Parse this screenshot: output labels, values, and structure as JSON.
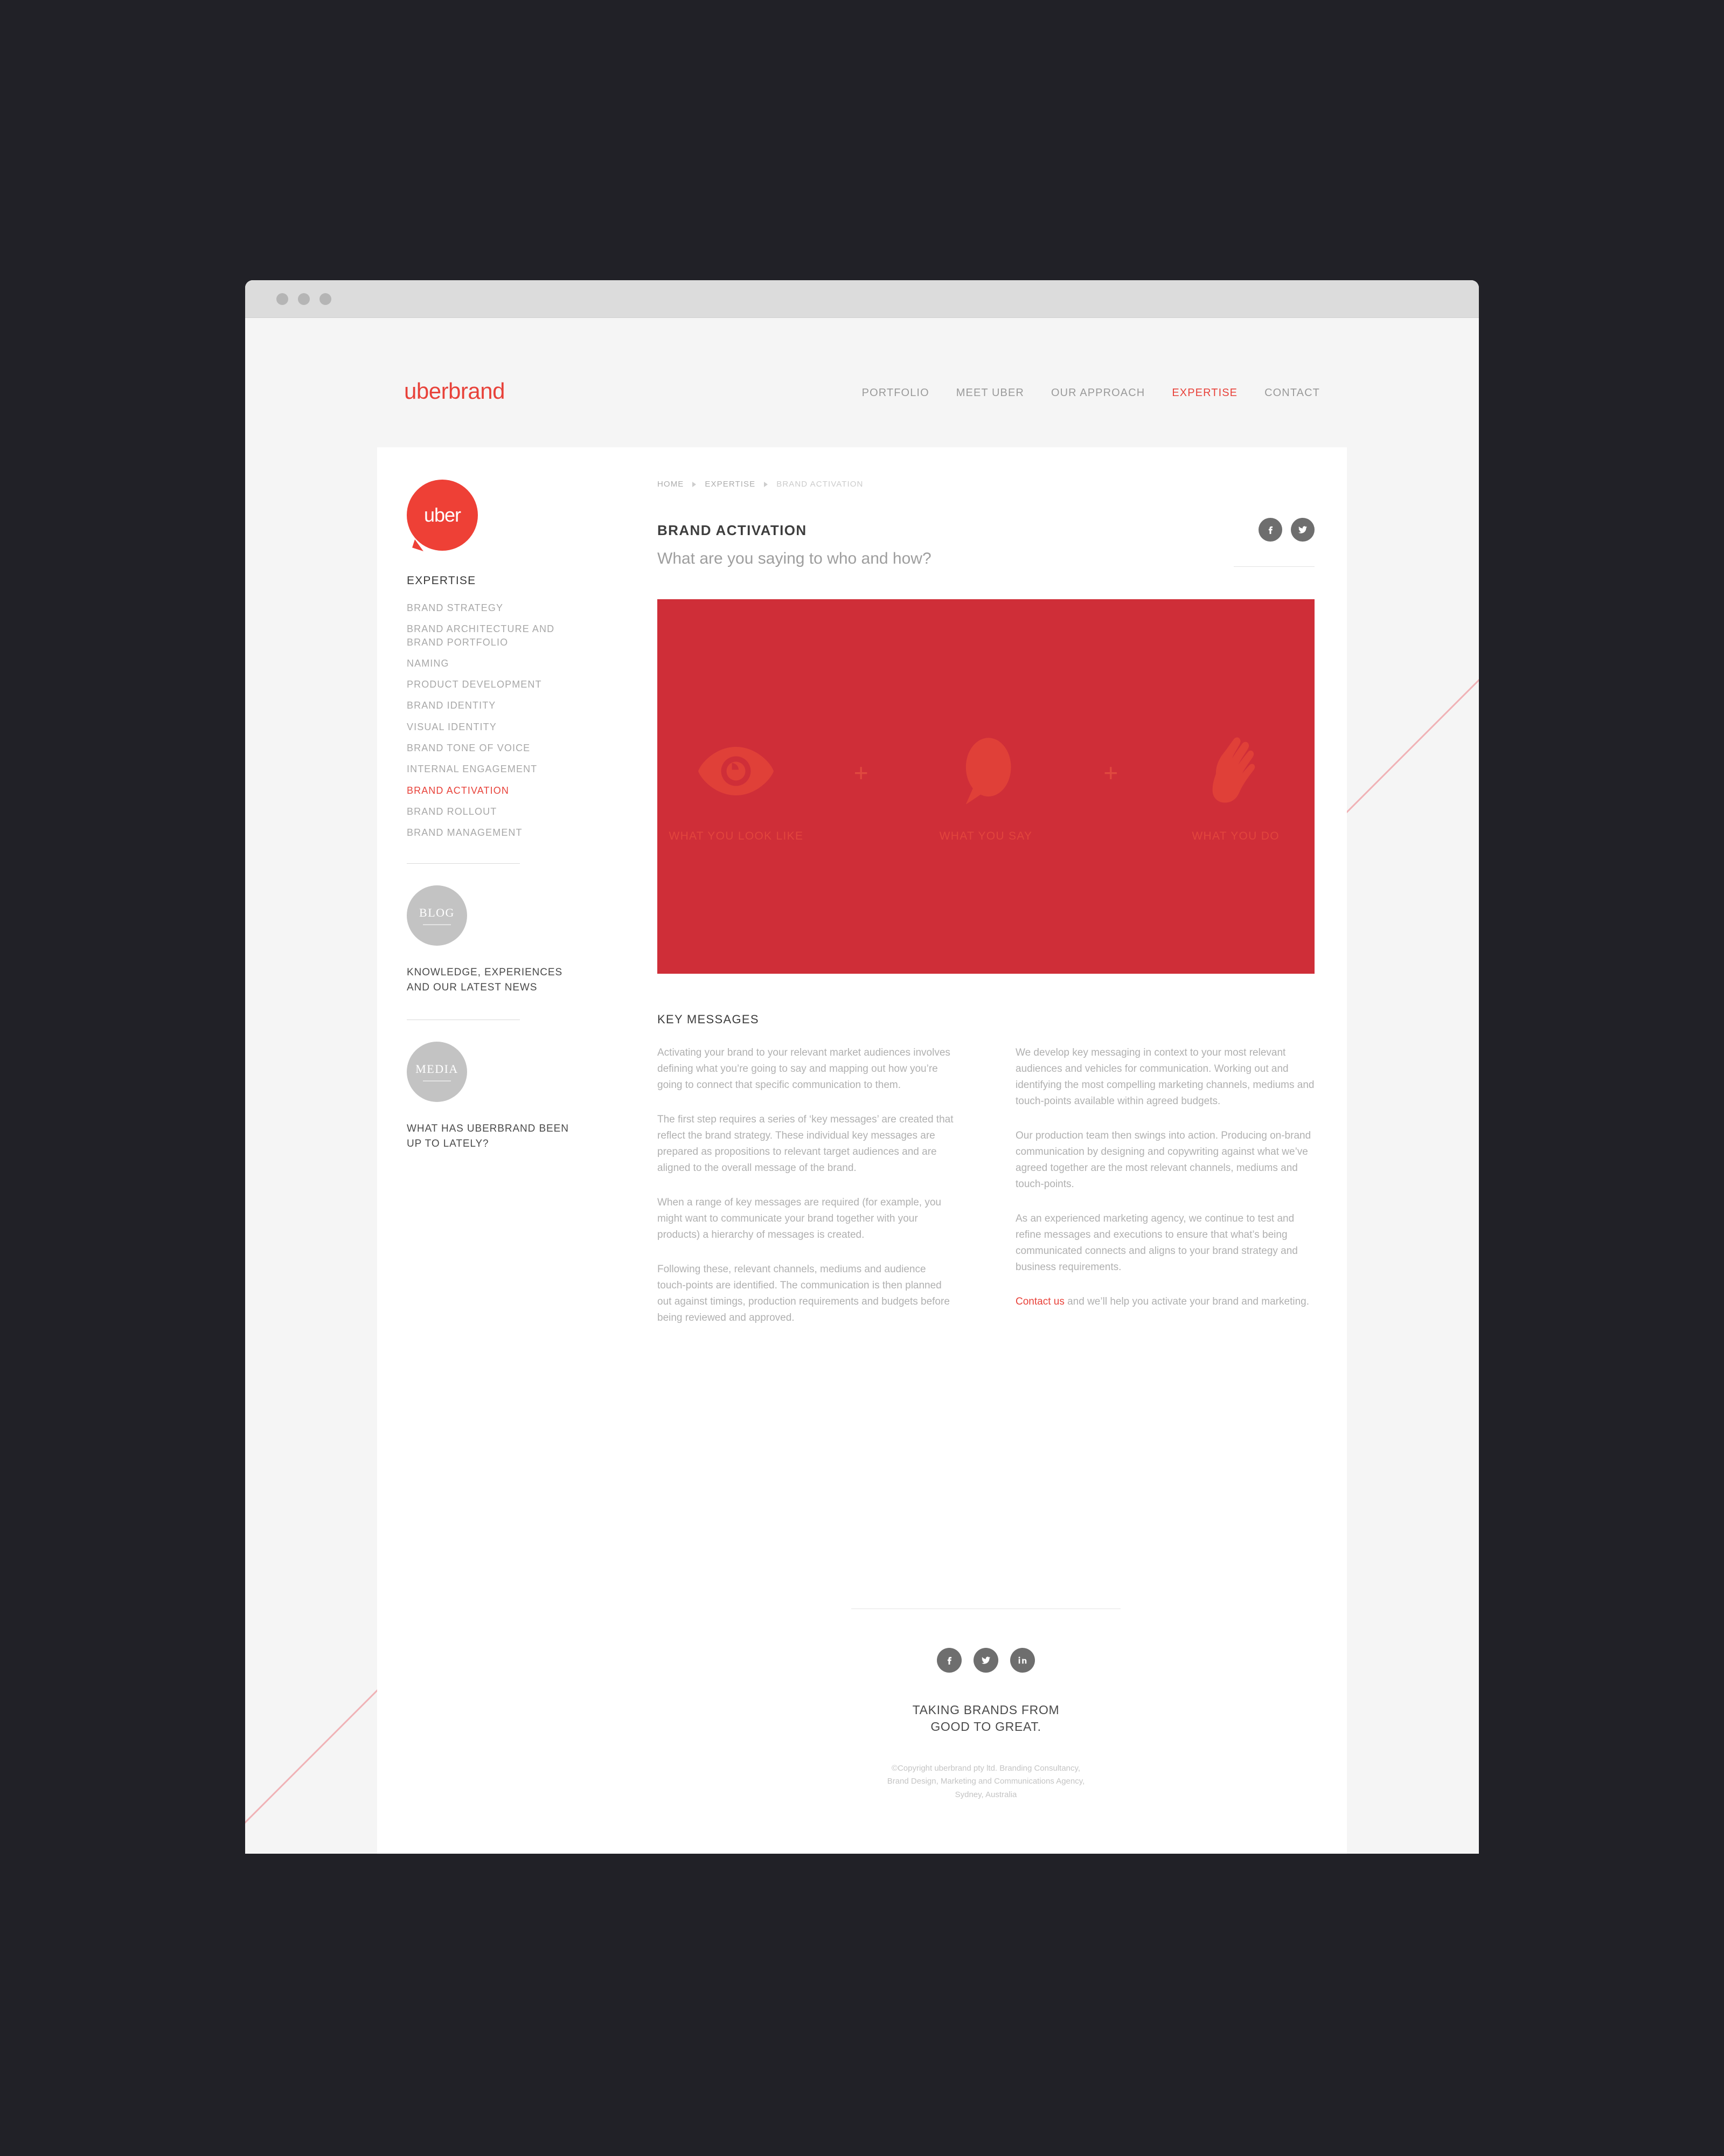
{
  "window": {
    "traffic_lights": [
      "close",
      "minimize",
      "maximize"
    ]
  },
  "header": {
    "logo": "uberbrand",
    "nav": [
      {
        "label": "PORTFOLIO",
        "active": false
      },
      {
        "label": "MEET UBER",
        "active": false
      },
      {
        "label": "OUR APPROACH",
        "active": false
      },
      {
        "label": "EXPERTISE",
        "active": true
      },
      {
        "label": "CONTACT",
        "active": false
      }
    ]
  },
  "sidebar": {
    "logo_bubble": "uber",
    "heading": "EXPERTISE",
    "items": [
      {
        "label": "BRAND STRATEGY",
        "active": false
      },
      {
        "label": "BRAND ARCHITECTURE AND BRAND PORTFOLIO",
        "active": false
      },
      {
        "label": "NAMING",
        "active": false
      },
      {
        "label": "PRODUCT DEVELOPMENT",
        "active": false
      },
      {
        "label": "BRAND IDENTITY",
        "active": false
      },
      {
        "label": "VISUAL IDENTITY",
        "active": false
      },
      {
        "label": "BRAND TONE OF VOICE",
        "active": false
      },
      {
        "label": "INTERNAL ENGAGEMENT",
        "active": false
      },
      {
        "label": "BRAND ACTIVATION",
        "active": true
      },
      {
        "label": "BRAND ROLLOUT",
        "active": false
      },
      {
        "label": "BRAND MANAGEMENT",
        "active": false
      }
    ],
    "promos": [
      {
        "badge": "BLOG",
        "text": "KNOWLEDGE, EXPERIENCES AND OUR LATEST NEWS"
      },
      {
        "badge": "MEDIA",
        "text": "WHAT HAS UBERBRAND BEEN UP TO LATELY?"
      }
    ]
  },
  "main": {
    "breadcrumb": [
      {
        "label": "HOME",
        "current": false
      },
      {
        "label": "EXPERTISE",
        "current": false
      },
      {
        "label": "BRAND ACTIVATION",
        "current": true
      }
    ],
    "title": "BRAND ACTIVATION",
    "subtitle": "What are you saying to who and how?",
    "share": [
      {
        "name": "facebook-icon"
      },
      {
        "name": "twitter-icon"
      }
    ],
    "hero": {
      "background_color": "#cf2e38",
      "items": [
        {
          "icon": "eye-icon",
          "caption": "WHAT YOU LOOK LIKE"
        },
        {
          "icon": "speech-bubble-icon",
          "caption": "WHAT YOU SAY"
        },
        {
          "icon": "hand-icon",
          "caption": "WHAT YOU DO"
        }
      ],
      "separator": "+"
    },
    "section_heading": "KEY MESSAGES",
    "left_column": [
      "Activating your brand to your relevant market audiences involves defining what you’re going to say and mapping out how you’re going to connect that specific communication to them.",
      "The first step requires a series of ‘key messages’ are created that reflect the brand strategy. These individual key messages are prepared as propositions to relevant target audiences and are aligned to the overall message of the brand.",
      "When a range of key messages are required (for example, you might want to communicate your brand together with your products) a hierarchy of messages is created.",
      "Following these, relevant channels, mediums and audience touch-points are identified. The communication is then planned out against timings, production requirements and budgets before being reviewed and approved."
    ],
    "right_column": [
      "We develop key messaging in context to your most relevant audiences and vehicles for communication. Working out and identifying the most compelling marketing channels, mediums and touch-points available within agreed budgets.",
      "Our production team then swings into action. Producing on-brand communication by designing and copywriting against what we’ve agreed together are the most relevant channels, mediums and touch-points.",
      "As an experienced marketing agency, we continue to test and refine messages and executions to ensure that what’s being communicated connects and aligns to your brand strategy and business requirements."
    ],
    "cta": {
      "link": "Contact us",
      "rest": " and we’ll help you activate your brand and marketing."
    }
  },
  "footer": {
    "social": [
      {
        "name": "facebook-icon"
      },
      {
        "name": "twitter-icon"
      },
      {
        "name": "linkedin-icon"
      }
    ],
    "tagline_line1": "TAKING BRANDS FROM",
    "tagline_line2": "GOOD TO GREAT.",
    "copyright": "©Copyright uberbrand pty ltd. Branding Consultancy, Brand Design, Marketing and Communications Agency, Sydney, Australia"
  },
  "colors": {
    "brand_red": "#e8423a",
    "hero_red": "#cf2e38",
    "backdrop": "#212127",
    "page_bg": "#f5f5f5",
    "card_bg": "#ffffff",
    "muted_text": "#b0b0b0",
    "diagonal": "#f0b2b6"
  }
}
